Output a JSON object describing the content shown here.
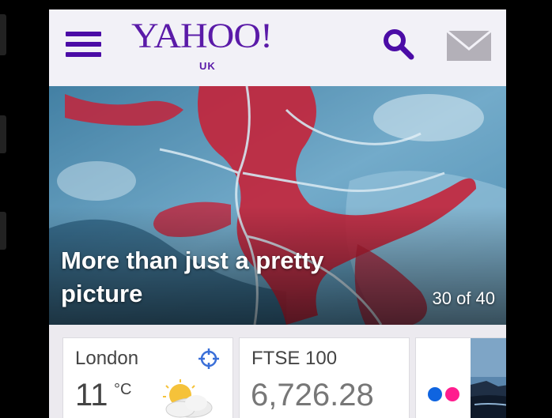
{
  "header": {
    "logo_text": "YAHOO!",
    "logo_region": "UK",
    "menu_icon": "hamburger-menu-icon",
    "search_icon": "search-icon",
    "mail_icon": "mail-icon",
    "brand_color": "#5a1aa8"
  },
  "hero": {
    "title": "More than just a pretty picture",
    "counter": "30 of 40"
  },
  "cards": {
    "weather": {
      "city": "London",
      "temperature": "11",
      "unit": "°C",
      "locate_icon": "location-crosshair-icon",
      "condition_icon": "partly-cloudy-icon"
    },
    "market": {
      "index_name": "FTSE 100",
      "value": "6,726.28"
    },
    "photos": {
      "brand_icon": "flickr-icon",
      "thumbnail": "photo-thumbnail"
    }
  }
}
